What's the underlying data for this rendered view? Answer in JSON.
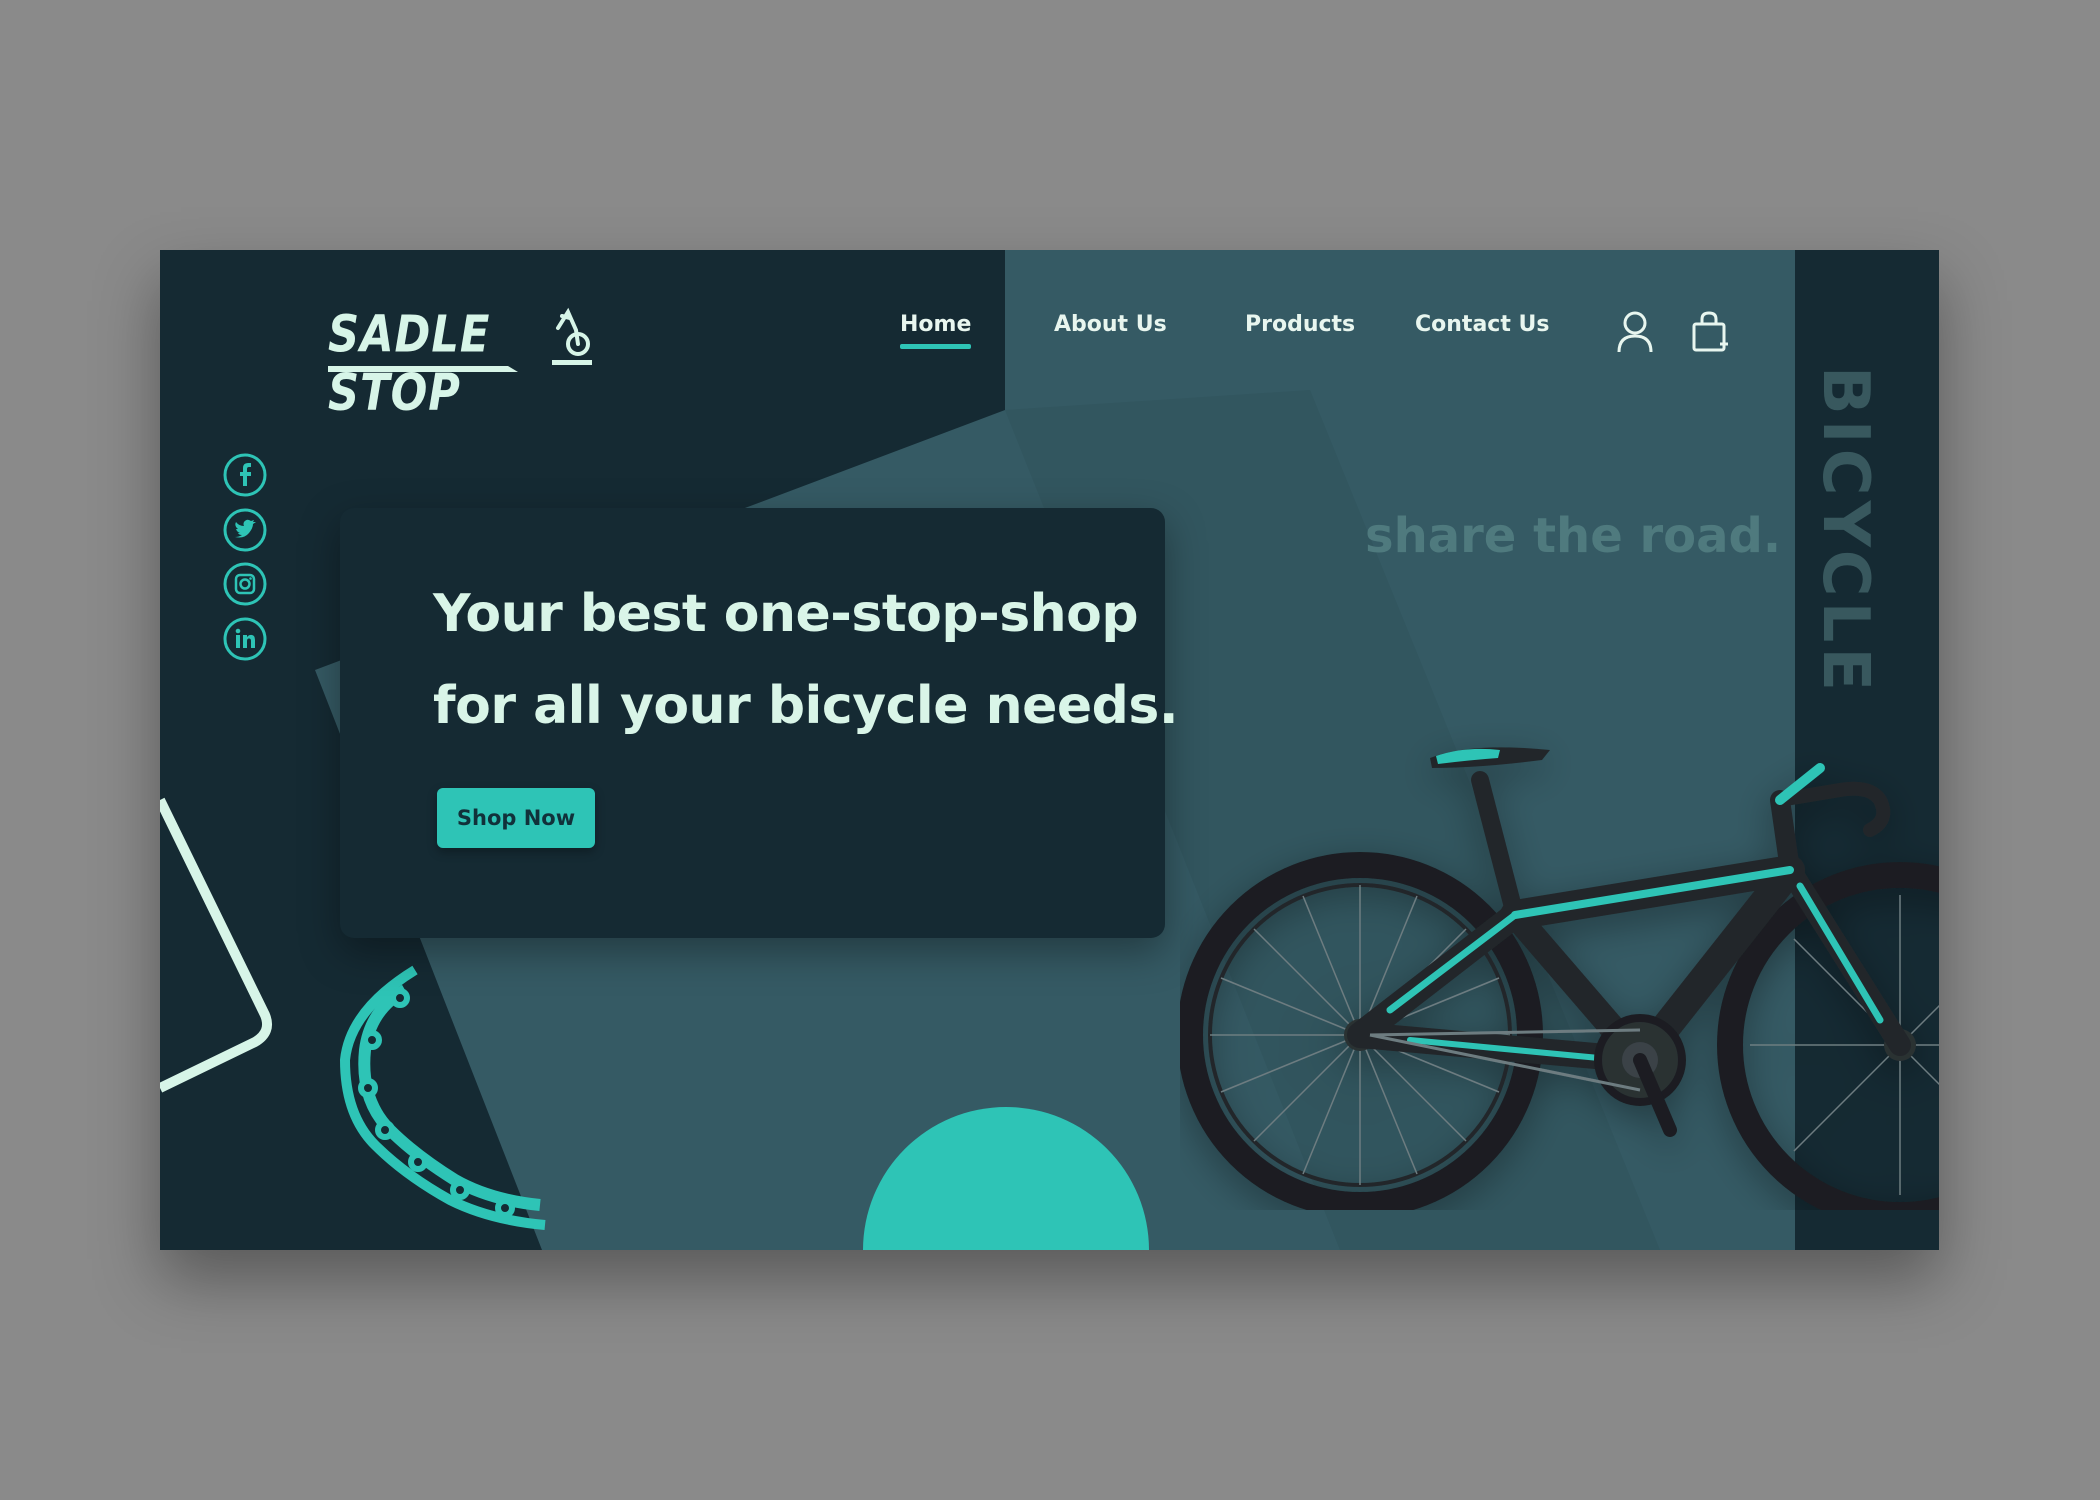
{
  "brand": {
    "name": "SADLE STOP",
    "logo_icon": "bicycle-rider-icon"
  },
  "nav": {
    "items": [
      {
        "label": "Home",
        "active": true
      },
      {
        "label": "About Us",
        "active": false
      },
      {
        "label": "Products",
        "active": false
      },
      {
        "label": "Contact Us",
        "active": false
      }
    ],
    "icons": [
      "user-icon",
      "shopping-bag-icon"
    ]
  },
  "social": [
    "facebook-icon",
    "twitter-icon",
    "instagram-icon",
    "linkedin-icon"
  ],
  "hero": {
    "line1": "Your best one-stop-shop",
    "line2": "for all your bicycle needs.",
    "cta": "Shop Now"
  },
  "tagline": "share the road.",
  "side_word": "BICYCLE",
  "colors": {
    "dark": "#152a33",
    "panel": "#355a64",
    "accent": "#2ec4b6",
    "text_light": "#d9f5e8"
  }
}
